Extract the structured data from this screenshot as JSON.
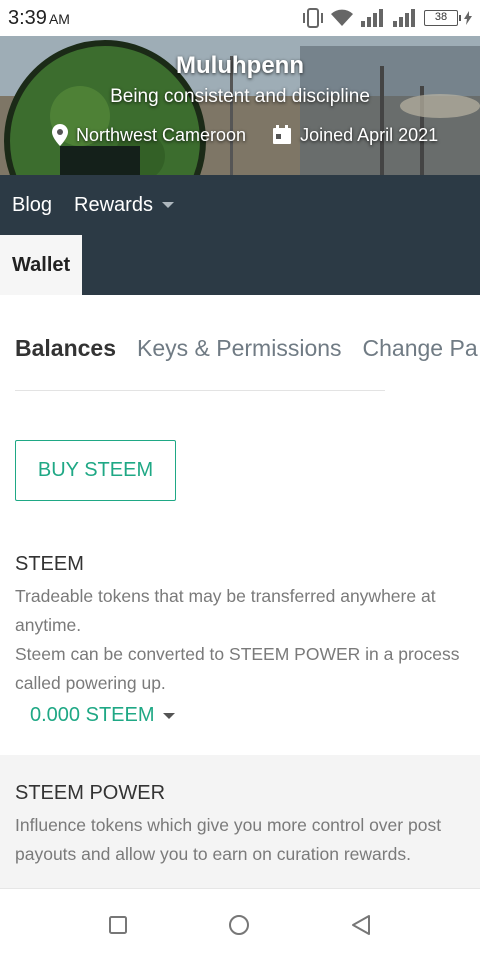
{
  "status_bar": {
    "time": "3:39",
    "ampm": "AM",
    "battery": "38"
  },
  "profile": {
    "name": "Muluhpenn",
    "tagline": "Being consistent and discipline",
    "location": "Northwest Cameroon",
    "joined": "Joined April 2021"
  },
  "nav": {
    "blog": "Blog",
    "rewards": "Rewards",
    "wallet": "Wallet"
  },
  "tabs": [
    {
      "label": "Balances",
      "active": true
    },
    {
      "label": "Keys & Permissions",
      "active": false
    },
    {
      "label": "Change Pa",
      "active": false
    }
  ],
  "buy_button": "BUY STEEM",
  "steem": {
    "title": "STEEM",
    "description_1": "Tradeable tokens that may be transferred anywhere at anytime.",
    "description_2": "Steem can be converted to STEEM POWER in a process called powering up.",
    "balance": "0.000 STEEM"
  },
  "steem_power": {
    "title": "STEEM POWER",
    "description": "Influence tokens which give you more control over post payouts and allow you to earn on curation rewards."
  },
  "colors": {
    "accent": "#1fa885",
    "nav_bg": "#2c3a45"
  }
}
